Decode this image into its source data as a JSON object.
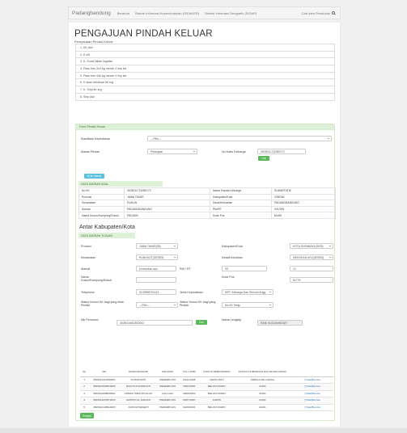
{
  "navbar": {
    "brand": "Padangbandung",
    "links": [
      "Beranda",
      "Sistem Informasi Kependudukan (SIDAKER)",
      "Sistem Informasi Geografis (SIGAP)"
    ],
    "right_label": "Cari data Penduduk"
  },
  "page": {
    "title": "PENGAJUAN PINDAH KELUAR",
    "subtitle": "Persyaratan Pindah Keluar"
  },
  "requirements": [
    "1. KK Asli",
    "2. K-KK",
    "3. K. Surat Nikah legalisir",
    "4. Pass foto 3x4 bg merah 4 lmp kel",
    "5. Pass foto 4x6 bg merah 4 lmp kel",
    "6. K akan terbitkan lbr srg",
    "7. K. Ship lbr srg",
    "8. Ship Asli"
  ],
  "form": {
    "panel_title": "Form Pindah Keluar",
    "klasifikasi_label": "Klasifikasi Kepindahan",
    "klasifikasi_value": "---Pilih---",
    "alasan_label": "Alasan Pindah",
    "alasan_value": "Pekerjaan",
    "no_kk_label": "No Kartu Keluarga",
    "no_kk_value": "3525011711080172",
    "cari_button": "Cari",
    "isi_button": "Isi ke bawah",
    "asal_title": "DATA DAERAH ASAL",
    "asal_rows": [
      [
        "No KK",
        "3525011711080172",
        "Nama Kepala Keluarga",
        "SUHARTATIK"
      ],
      [
        "Provinsi",
        "JAWA TIMUR",
        "Kabupaten/Kota",
        "GRESIK"
      ],
      [
        "Kecamatan",
        "DUKUN",
        "Desa/Kelurahan",
        "PADANGBANDUNG"
      ],
      [
        "Alamat",
        "PADANGBANDUNG",
        "RW/RT",
        "001/005"
      ],
      [
        "Nama Dusun/Kampung/Dukuh",
        "PADANG",
        "Kode Pos",
        "61155"
      ]
    ],
    "antar_title": "Antar Kabupaten/Kota",
    "tujuan_title": "DATA DAERAH TUJUAN",
    "tujuan": {
      "provinsi_label": "Provinsi",
      "provinsi_value": "JAWA TIMUR(35)",
      "kabupaten_label": "Kabupaten/Kota",
      "kabupaten_value": "KOTA SURABAYA(3578)",
      "kecamatan_label": "Kecamatan",
      "kecamatan_value": "RUNGKUT(357805)",
      "desa_label": "Desa/Kelurahan",
      "desa_value": "MEDOKAN AYU(357805)",
      "alamat_label": "Alamat",
      "alamat_value": "jl medokan ayu",
      "rtrw_label": "RW / RT",
      "rw_value": "05",
      "rt_value": "12",
      "dusun_label": "Nama Dusun/Kampung/Dukuh",
      "dusun_value": "-",
      "kodepos_label": "Kode Pos",
      "kodepos_value": "61776",
      "telepon_label": "Telephone",
      "telepon_value": "0123998791123",
      "jenis_label": "Jenis Kepindahan",
      "jenis_value": "KEP. Keluarga Dan Seluruh Angg",
      "status_tidak_label": "Status Nomor KK bagi yang tidak Pindah",
      "status_tidak_value": "---Pilih---",
      "status_pindah_label": "Status Nomor KK bagi yang Pindah",
      "status_pindah_value": "No KK Tetap"
    },
    "nik_label": "Nik Pemohon",
    "nik_value": "3525014602810002",
    "nama_label": "Nama Lengkap",
    "nama_value": "RANI SUCIANINGATI",
    "kel_headers": [
      "No",
      "NIK",
      "NAMA LENGKAP",
      "KELAMIN",
      "TGL LAHIR",
      "STATUS PERKAWINAN",
      "STATUS HUBUNGAN DALAM KELUARGA",
      ""
    ],
    "kel_rows": [
      [
        "1",
        "3525014411650002",
        "SUHARTATIK",
        "PEREMPUAN",
        "04/11/1965",
        "CERAI MATI",
        "KEPALA KELUARGA",
        "[Tidak]Bersiko"
      ],
      [
        "2",
        "3525014602810003",
        "RANI SUCIANINGATI",
        "PEREMPUAN",
        "26/02/1981",
        "BELUM KAWIN",
        "ANAK",
        "[Tidak]Bersiko"
      ],
      [
        "3",
        "3525012808840001",
        "AHMAD HIDAYATULLAH",
        "LAKI-LAKI",
        "28/08/1984",
        "BELUM KAWIN",
        "ANAK",
        "[Tidak]Bersiko"
      ],
      [
        "4",
        "3525014207870004",
        "ZAHROTUL JANNAH",
        "PEREMPUAN",
        "02/07/1987",
        "KAWIN",
        "ANAK",
        "[Tidak]Bersiko"
      ],
      [
        "5",
        "3525014108910003",
        "ANIS FATMAWATI",
        "PEREMPUAN",
        "01/08/1991",
        "BELUM KAWIN",
        "ANAK",
        "[Tidak]Bersiko"
      ]
    ],
    "simpan_button": "Simpan"
  },
  "colors": {
    "panel_header": "#dff0d8",
    "accent_green": "#5cb85c",
    "accent_blue": "#5bc0de"
  }
}
